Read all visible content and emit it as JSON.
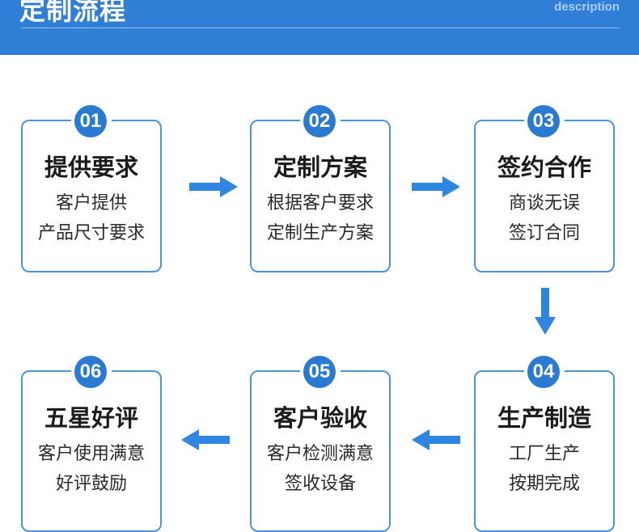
{
  "header": {
    "title": "定制流程",
    "subtitle": "description"
  },
  "colors": {
    "header_bg": "#2f7fd6",
    "accent": "#2a7ad2",
    "border": "#4b94dc",
    "arrow": "#2f86e0"
  },
  "steps": [
    {
      "number": "01",
      "title": "提供要求",
      "line1": "客户提供",
      "line2": "产品尺寸要求"
    },
    {
      "number": "02",
      "title": "定制方案",
      "line1": "根据客户要求",
      "line2": "定制生产方案"
    },
    {
      "number": "03",
      "title": "签约合作",
      "line1": "商谈无误",
      "line2": "签订合同"
    },
    {
      "number": "04",
      "title": "生产制造",
      "line1": "工厂生产",
      "line2": "按期完成"
    },
    {
      "number": "05",
      "title": "客户验收",
      "line1": "客户检测满意",
      "line2": "签收设备"
    },
    {
      "number": "06",
      "title": "五星好评",
      "line1": "客户使用满意",
      "line2": "好评鼓励"
    }
  ],
  "arrows": [
    {
      "from": "01",
      "to": "02",
      "direction": "right"
    },
    {
      "from": "02",
      "to": "03",
      "direction": "right"
    },
    {
      "from": "03",
      "to": "04",
      "direction": "down"
    },
    {
      "from": "04",
      "to": "05",
      "direction": "left"
    },
    {
      "from": "05",
      "to": "06",
      "direction": "left"
    }
  ]
}
